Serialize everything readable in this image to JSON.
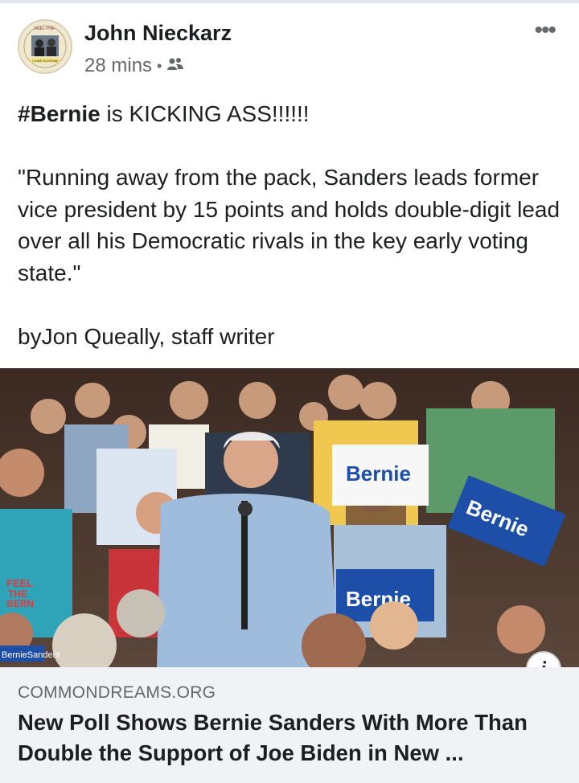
{
  "post": {
    "author": "John Nieckarz",
    "time": "28 mins",
    "separator": "•",
    "audience_icon": "friends-icon",
    "more_icon": "more-options-icon",
    "text": {
      "hashtag": "#Bernie",
      "line1_rest": " is KICKING ASS!!!!!!",
      "quote": "\"Running away from the pack, Sanders leads former vice president by 15 points and holds double-digit lead over all his Democratic rivals in the key early voting state.\"",
      "byline": "byJon Queally, staff writer"
    }
  },
  "avatar_badge": {
    "top_text": "FEEL-THE-",
    "bottom_text": "I HAVE A DREAM"
  },
  "photo": {
    "signs": [
      "Bernie",
      "Bernie",
      "Bernie"
    ],
    "shirt_text": [
      "FEEL",
      "THE",
      "BERN"
    ],
    "banner_text": "BernieSanders"
  },
  "link_preview": {
    "domain": "COMMONDREAMS.ORG",
    "headline": "New Poll Shows Bernie Sanders With More Than Double the Support of Joe Biden in New ...",
    "info_icon": "info-icon",
    "info_glyph": "i"
  },
  "colors": {
    "text_primary": "#1c1e21",
    "text_secondary": "#65676b",
    "link_bg": "#f0f2f5",
    "sign_blue": "#1d4fa8"
  }
}
